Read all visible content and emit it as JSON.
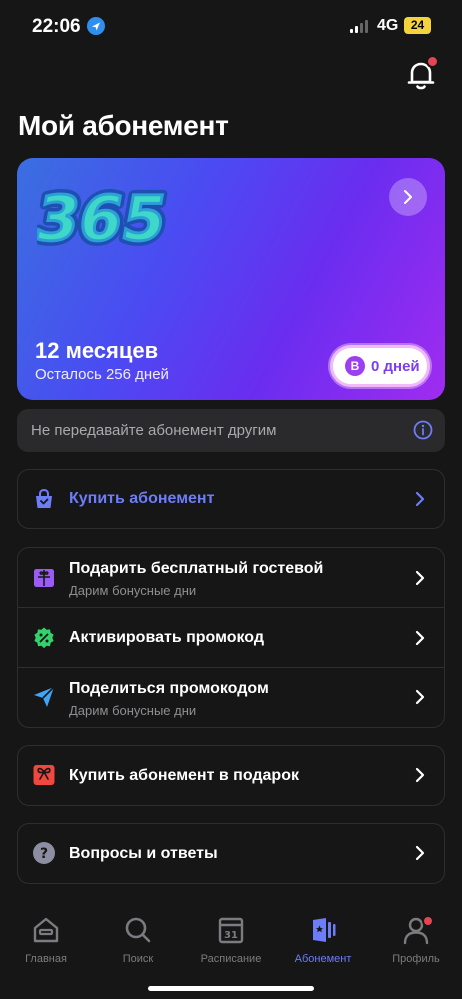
{
  "status_bar": {
    "time": "22:06",
    "network": "4G",
    "battery": "24"
  },
  "header": {
    "title": "Мой абонемент"
  },
  "subscription": {
    "logo_text": "365",
    "title": "12 месяцев",
    "remaining": "Осталось 256 дней",
    "badge_letter": "В",
    "days": "0 дней"
  },
  "notice": {
    "text": "Не передавайте абонемент другим"
  },
  "buy": {
    "label": "Купить абонемент"
  },
  "actions": [
    {
      "label": "Подарить бесплатный гостевой",
      "sub": "Дарим бонусные дни"
    },
    {
      "label": "Активировать промокод",
      "sub": ""
    },
    {
      "label": "Поделиться промокодом",
      "sub": "Дарим бонусные дни"
    }
  ],
  "gift": {
    "label": "Купить абонемент в подарок"
  },
  "faq": {
    "label": "Вопросы и ответы",
    "icon_glyph": "?"
  },
  "calendar_day": "31",
  "tabs": [
    {
      "label": "Главная",
      "icon": "home-icon"
    },
    {
      "label": "Поиск",
      "icon": "search-icon"
    },
    {
      "label": "Расписание",
      "icon": "calendar-icon"
    },
    {
      "label": "Абонемент",
      "icon": "membership-card-icon",
      "active": true
    },
    {
      "label": "Профиль",
      "icon": "profile-icon"
    }
  ],
  "colors": {
    "background": "#161616",
    "accent": "#6d7cf7",
    "notification": "#e54553",
    "card_gradient_start": "#3a6fe0",
    "card_gradient_end": "#a02cf0"
  }
}
